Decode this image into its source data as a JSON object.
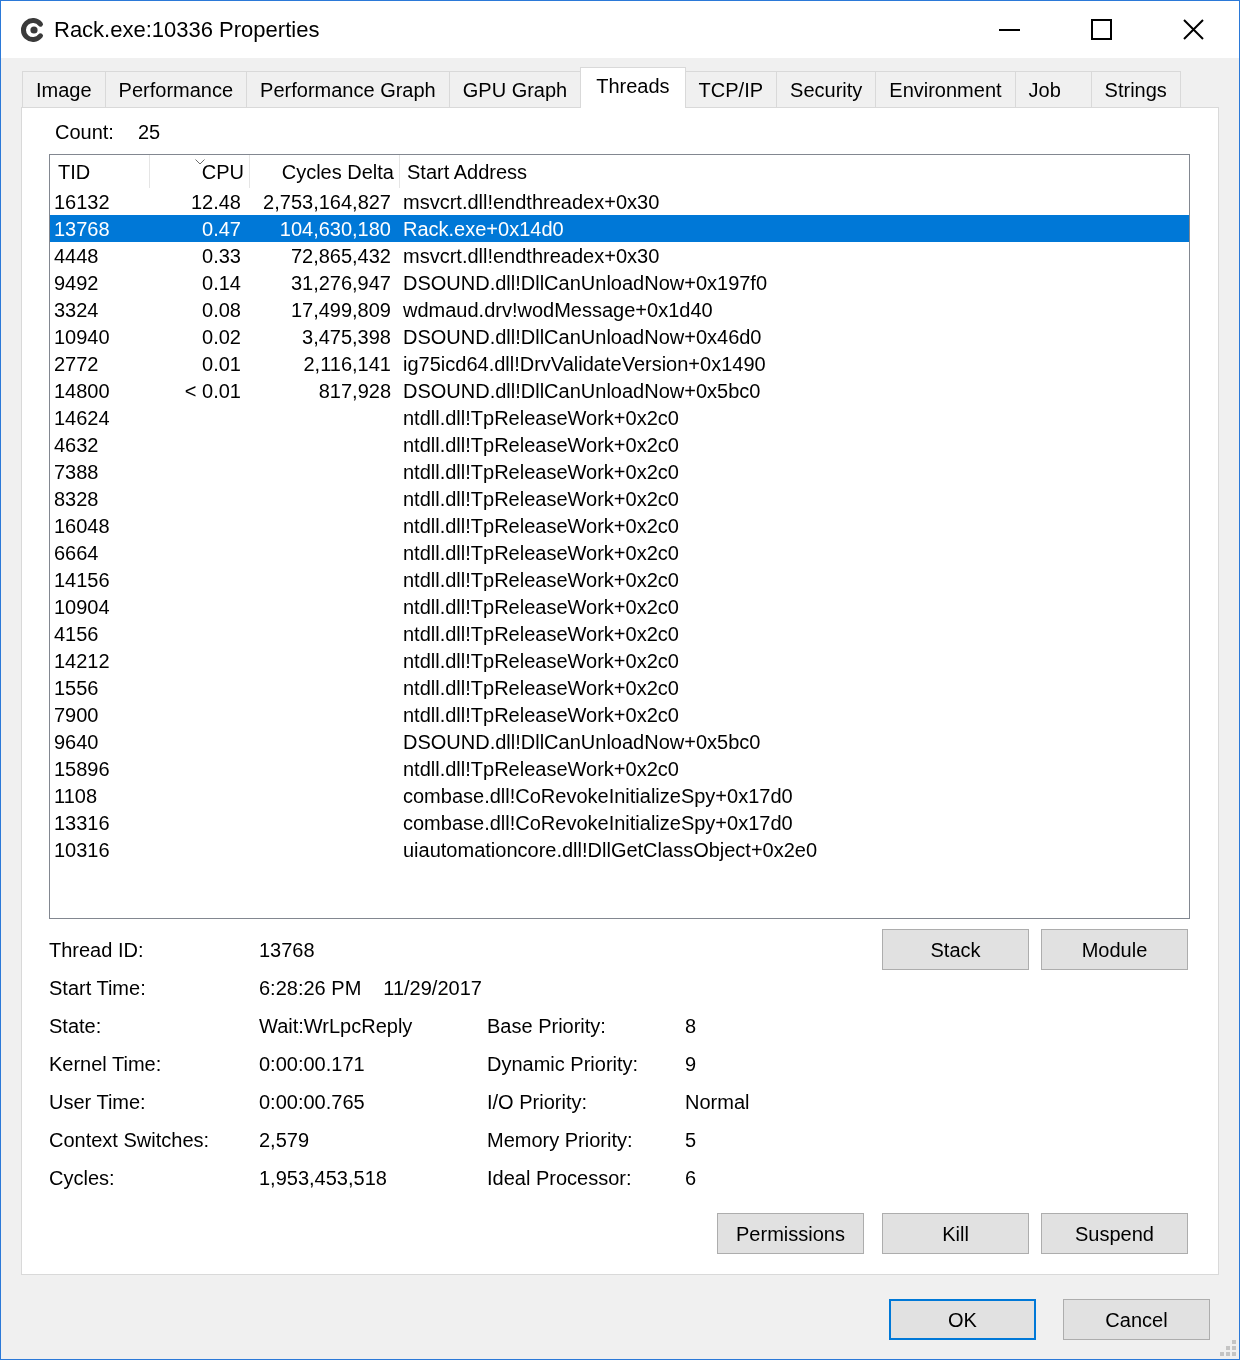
{
  "window": {
    "title": "Rack.exe:10336 Properties"
  },
  "tabs": [
    {
      "label": "Image",
      "selected": false
    },
    {
      "label": "Performance",
      "selected": false
    },
    {
      "label": "Performance Graph",
      "selected": false
    },
    {
      "label": "GPU Graph",
      "selected": false
    },
    {
      "label": "Threads",
      "selected": true
    },
    {
      "label": "TCP/IP",
      "selected": false
    },
    {
      "label": "Security",
      "selected": false
    },
    {
      "label": "Environment",
      "selected": false
    },
    {
      "label": "Job",
      "selected": false
    },
    {
      "label": "Strings",
      "selected": false
    }
  ],
  "count": {
    "label": "Count:",
    "value": "25"
  },
  "thread_list": {
    "columns": [
      {
        "label": "TID",
        "kind": "text",
        "sorted": false
      },
      {
        "label": "CPU",
        "kind": "number",
        "sorted": true
      },
      {
        "label": "Cycles Delta",
        "kind": "number",
        "sorted": false
      },
      {
        "label": "Start Address",
        "kind": "text",
        "sorted": false
      }
    ],
    "rows": [
      {
        "cells": [
          "16132",
          "12.48",
          "2,753,164,827",
          "msvcrt.dll!endthreadex+0x30"
        ],
        "selected": false
      },
      {
        "cells": [
          "13768",
          "0.47",
          "104,630,180",
          "Rack.exe+0x14d0"
        ],
        "selected": true
      },
      {
        "cells": [
          "4448",
          "0.33",
          "72,865,432",
          "msvcrt.dll!endthreadex+0x30"
        ],
        "selected": false
      },
      {
        "cells": [
          "9492",
          "0.14",
          "31,276,947",
          "DSOUND.dll!DllCanUnloadNow+0x197f0"
        ],
        "selected": false
      },
      {
        "cells": [
          "3324",
          "0.08",
          "17,499,809",
          "wdmaud.drv!wodMessage+0x1d40"
        ],
        "selected": false
      },
      {
        "cells": [
          "10940",
          "0.02",
          "3,475,398",
          "DSOUND.dll!DllCanUnloadNow+0x46d0"
        ],
        "selected": false
      },
      {
        "cells": [
          "2772",
          "0.01",
          "2,116,141",
          "ig75icd64.dll!DrvValidateVersion+0x1490"
        ],
        "selected": false
      },
      {
        "cells": [
          "14800",
          "< 0.01",
          "817,928",
          "DSOUND.dll!DllCanUnloadNow+0x5bc0"
        ],
        "selected": false
      },
      {
        "cells": [
          "14624",
          null,
          null,
          "ntdll.dll!TpReleaseWork+0x2c0"
        ],
        "selected": false
      },
      {
        "cells": [
          "4632",
          null,
          null,
          "ntdll.dll!TpReleaseWork+0x2c0"
        ],
        "selected": false
      },
      {
        "cells": [
          "7388",
          null,
          null,
          "ntdll.dll!TpReleaseWork+0x2c0"
        ],
        "selected": false
      },
      {
        "cells": [
          "8328",
          null,
          null,
          "ntdll.dll!TpReleaseWork+0x2c0"
        ],
        "selected": false
      },
      {
        "cells": [
          "16048",
          null,
          null,
          "ntdll.dll!TpReleaseWork+0x2c0"
        ],
        "selected": false
      },
      {
        "cells": [
          "6664",
          null,
          null,
          "ntdll.dll!TpReleaseWork+0x2c0"
        ],
        "selected": false
      },
      {
        "cells": [
          "14156",
          null,
          null,
          "ntdll.dll!TpReleaseWork+0x2c0"
        ],
        "selected": false
      },
      {
        "cells": [
          "10904",
          null,
          null,
          "ntdll.dll!TpReleaseWork+0x2c0"
        ],
        "selected": false
      },
      {
        "cells": [
          "4156",
          null,
          null,
          "ntdll.dll!TpReleaseWork+0x2c0"
        ],
        "selected": false
      },
      {
        "cells": [
          "14212",
          null,
          null,
          "ntdll.dll!TpReleaseWork+0x2c0"
        ],
        "selected": false
      },
      {
        "cells": [
          "1556",
          null,
          null,
          "ntdll.dll!TpReleaseWork+0x2c0"
        ],
        "selected": false
      },
      {
        "cells": [
          "7900",
          null,
          null,
          "ntdll.dll!TpReleaseWork+0x2c0"
        ],
        "selected": false
      },
      {
        "cells": [
          "9640",
          null,
          null,
          "DSOUND.dll!DllCanUnloadNow+0x5bc0"
        ],
        "selected": false
      },
      {
        "cells": [
          "15896",
          null,
          null,
          "ntdll.dll!TpReleaseWork+0x2c0"
        ],
        "selected": false
      },
      {
        "cells": [
          "1108",
          null,
          null,
          "combase.dll!CoRevokeInitializeSpy+0x17d0"
        ],
        "selected": false
      },
      {
        "cells": [
          "13316",
          null,
          null,
          "combase.dll!CoRevokeInitializeSpy+0x17d0"
        ],
        "selected": false
      },
      {
        "cells": [
          "10316",
          null,
          null,
          "uiautomationcore.dll!DllGetClassObject+0x2e0"
        ],
        "selected": false
      }
    ]
  },
  "thread_info": {
    "left": [
      {
        "label": "Thread ID:",
        "values": [
          "13768"
        ]
      },
      {
        "label": "Start Time:",
        "values": [
          "6:28:26 PM",
          "11/29/2017"
        ]
      },
      {
        "label": "State:",
        "values": [
          "Wait:WrLpcReply"
        ]
      },
      {
        "label": "Kernel Time:",
        "values": [
          "0:00:00.171"
        ]
      },
      {
        "label": "User Time:",
        "values": [
          "0:00:00.765"
        ]
      },
      {
        "label": "Context Switches:",
        "values": [
          "2,579"
        ]
      },
      {
        "label": "Cycles:",
        "values": [
          "1,953,453,518"
        ]
      }
    ],
    "right": [
      {
        "label": "Base Priority:",
        "values": [
          "8"
        ]
      },
      {
        "label": "Dynamic Priority:",
        "values": [
          "9"
        ]
      },
      {
        "label": "I/O Priority:",
        "values": [
          "Normal"
        ]
      },
      {
        "label": "Memory Priority:",
        "values": [
          "5"
        ]
      },
      {
        "label": "Ideal Processor:",
        "values": [
          "6"
        ]
      }
    ]
  },
  "thread_buttons": [
    {
      "label": "Stack"
    },
    {
      "label": "Module"
    }
  ],
  "action_buttons": [
    {
      "label": "Permissions"
    },
    {
      "label": "Kill"
    },
    {
      "label": "Suspend"
    }
  ],
  "dialog_buttons": [
    {
      "label": "OK",
      "default": true
    },
    {
      "label": "Cancel",
      "default": false
    }
  ]
}
